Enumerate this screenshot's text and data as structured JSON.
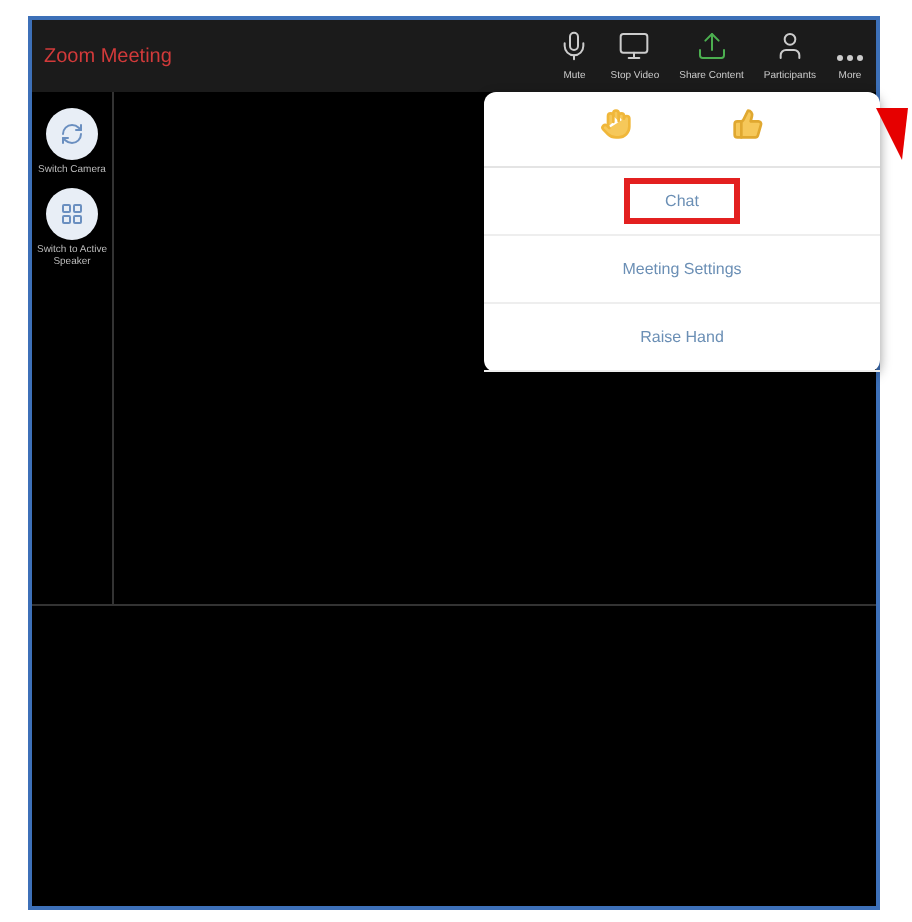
{
  "window": {
    "title": "Zoom Meeting"
  },
  "toolbar": [
    {
      "kind": "mic",
      "label": "Mute"
    },
    {
      "kind": "video",
      "label": "Stop Video"
    },
    {
      "kind": "share",
      "label": "Share Content"
    },
    {
      "kind": "participants",
      "label": "Participants"
    },
    {
      "kind": "more",
      "label": "More"
    }
  ],
  "side_buttons": [
    {
      "kind": "camera",
      "label": "Switch Camera"
    },
    {
      "kind": "gallery",
      "label": "Switch to Active Speaker"
    }
  ],
  "menu": {
    "reactions": [
      {
        "kind": "clap"
      },
      {
        "kind": "thumbs"
      }
    ],
    "items": [
      {
        "label": "Chat",
        "highlighted": true
      },
      {
        "label": "Meeting Settings",
        "highlighted": false
      },
      {
        "label": "Raise Hand",
        "highlighted": false
      }
    ]
  }
}
